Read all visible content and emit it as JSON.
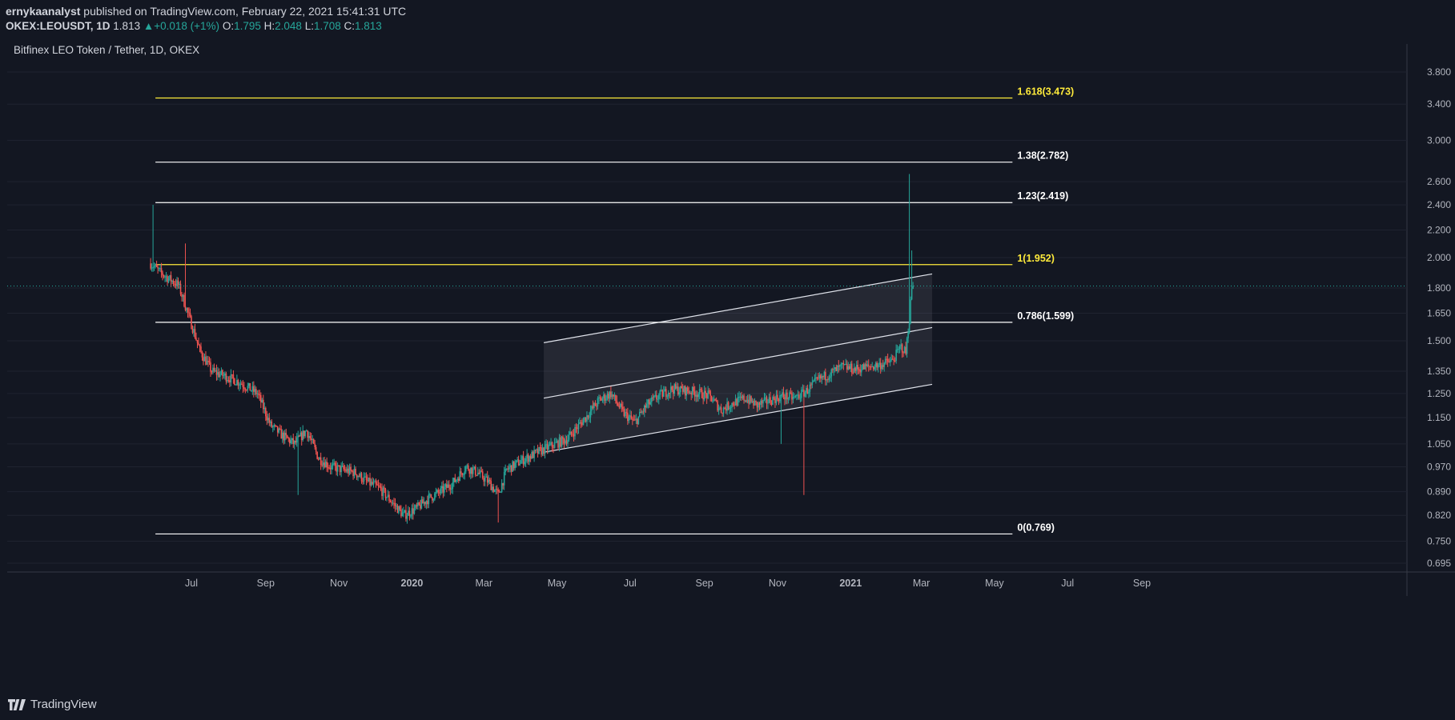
{
  "header": {
    "author": "ernykaanalyst",
    "published_text": " published on TradingView.com, February 22, 2021 15:41:31 UTC",
    "symbol": "OKEX:LEOUSDT, 1D",
    "last": "1.813",
    "change_arrow": "▲",
    "change": "+0.018 (+1%)",
    "o_label": "O:",
    "o_value": "1.795",
    "h_label": "H:",
    "h_value": "2.048",
    "l_label": "L:",
    "l_value": "1.708",
    "c_label": "C:",
    "c_value": "1.813"
  },
  "footer": {
    "brand": "TradingView"
  },
  "colors": {
    "background": "#131722",
    "grid": "#1f2330",
    "up": "#26a69a",
    "down": "#ef5350",
    "fib_yellow": "#ffeb3b",
    "fib_white": "#ffffff",
    "channel_fill": "#787b86"
  },
  "chart_data": {
    "type": "candlestick",
    "title": "Bitfinex LEO Token / Tether, 1D, OKEX",
    "scale": "log",
    "last_price": 1.813,
    "y_ticks": [
      "3.800",
      "3.400",
      "3.000",
      "2.600",
      "2.400",
      "2.200",
      "2.000",
      "1.800",
      "1.650",
      "1.500",
      "1.350",
      "1.250",
      "1.150",
      "1.050",
      "0.970",
      "0.890",
      "0.820",
      "0.750",
      "0.695"
    ],
    "x_ticks": [
      "Jul",
      "Sep",
      "Nov",
      "2020",
      "Mar",
      "May",
      "Jul",
      "Sep",
      "Nov",
      "2021",
      "Mar",
      "May",
      "Jul",
      "Sep"
    ],
    "fib_levels": [
      {
        "label": "1.618(3.473)",
        "value": 3.473,
        "color": "#ffeb3b"
      },
      {
        "label": "1.38(2.782)",
        "value": 2.782,
        "color": "#ffffff"
      },
      {
        "label": "1.23(2.419)",
        "value": 2.419,
        "color": "#ffffff"
      },
      {
        "label": "1(1.952)",
        "value": 1.952,
        "color": "#ffeb3b"
      },
      {
        "label": "0.786(1.599)",
        "value": 1.599,
        "color": "#ffffff"
      },
      {
        "label": "0(0.769)",
        "value": 0.769,
        "color": "#ffffff"
      }
    ],
    "fib_range": {
      "start": "2019-06-01",
      "end": "2021-05-16"
    },
    "channel": {
      "start": "2020-04-20",
      "end": "2021-03-10",
      "lower": [
        1.02,
        1.29
      ],
      "middle": [
        1.23,
        1.57
      ],
      "upper": [
        1.49,
        1.89
      ]
    },
    "price_path": [
      [
        "2019-05-28",
        1.96
      ],
      [
        "2019-06-05",
        1.9
      ],
      [
        "2019-06-12",
        1.86
      ],
      [
        "2019-06-20",
        1.82
      ],
      [
        "2019-06-28",
        1.65
      ],
      [
        "2019-07-08",
        1.45
      ],
      [
        "2019-07-18",
        1.35
      ],
      [
        "2019-07-28",
        1.33
      ],
      [
        "2019-08-10",
        1.3
      ],
      [
        "2019-08-25",
        1.25
      ],
      [
        "2019-09-05",
        1.12
      ],
      [
        "2019-09-15",
        1.08
      ],
      [
        "2019-09-25",
        1.05
      ],
      [
        "2019-10-05",
        1.1
      ],
      [
        "2019-10-15",
        1.0
      ],
      [
        "2019-10-25",
        0.97
      ],
      [
        "2019-11-05",
        0.96
      ],
      [
        "2019-11-15",
        0.95
      ],
      [
        "2019-11-25",
        0.92
      ],
      [
        "2019-12-05",
        0.9
      ],
      [
        "2019-12-15",
        0.86
      ],
      [
        "2019-12-25",
        0.82
      ],
      [
        "2020-01-05",
        0.84
      ],
      [
        "2020-01-15",
        0.87
      ],
      [
        "2020-01-25",
        0.89
      ],
      [
        "2020-02-05",
        0.92
      ],
      [
        "2020-02-15",
        0.97
      ],
      [
        "2020-02-25",
        0.95
      ],
      [
        "2020-03-05",
        0.92
      ],
      [
        "2020-03-13",
        0.88
      ],
      [
        "2020-03-20",
        0.96
      ],
      [
        "2020-04-01",
        0.99
      ],
      [
        "2020-04-15",
        1.02
      ],
      [
        "2020-04-25",
        1.04
      ],
      [
        "2020-05-10",
        1.07
      ],
      [
        "2020-05-25",
        1.15
      ],
      [
        "2020-06-05",
        1.22
      ],
      [
        "2020-06-15",
        1.25
      ],
      [
        "2020-06-25",
        1.17
      ],
      [
        "2020-07-05",
        1.13
      ],
      [
        "2020-07-15",
        1.2
      ],
      [
        "2020-07-25",
        1.24
      ],
      [
        "2020-08-05",
        1.27
      ],
      [
        "2020-08-20",
        1.26
      ],
      [
        "2020-09-05",
        1.24
      ],
      [
        "2020-09-15",
        1.18
      ],
      [
        "2020-09-25",
        1.21
      ],
      [
        "2020-10-05",
        1.23
      ],
      [
        "2020-10-15",
        1.2
      ],
      [
        "2020-10-25",
        1.22
      ],
      [
        "2020-11-05",
        1.24
      ],
      [
        "2020-11-15",
        1.23
      ],
      [
        "2020-11-25",
        1.26
      ],
      [
        "2020-12-05",
        1.31
      ],
      [
        "2020-12-15",
        1.34
      ],
      [
        "2020-12-25",
        1.37
      ],
      [
        "2021-01-05",
        1.36
      ],
      [
        "2021-01-15",
        1.37
      ],
      [
        "2021-01-25",
        1.38
      ],
      [
        "2021-02-05",
        1.4
      ],
      [
        "2021-02-12",
        1.47
      ],
      [
        "2021-02-16",
        1.44
      ],
      [
        "2021-02-19",
        1.62
      ],
      [
        "2021-02-21",
        1.8
      ],
      [
        "2021-02-22",
        1.813
      ]
    ],
    "wick_spikes": [
      {
        "date": "2019-05-30",
        "high": 2.4
      },
      {
        "date": "2019-06-26",
        "high": 2.1
      },
      {
        "date": "2019-09-28",
        "low": 0.88
      },
      {
        "date": "2020-03-13",
        "low": 0.8
      },
      {
        "date": "2020-11-04",
        "low": 1.05
      },
      {
        "date": "2020-11-23",
        "low": 0.88
      },
      {
        "date": "2021-02-19",
        "high": 2.67
      },
      {
        "date": "2021-02-21",
        "high": 2.05
      }
    ]
  }
}
